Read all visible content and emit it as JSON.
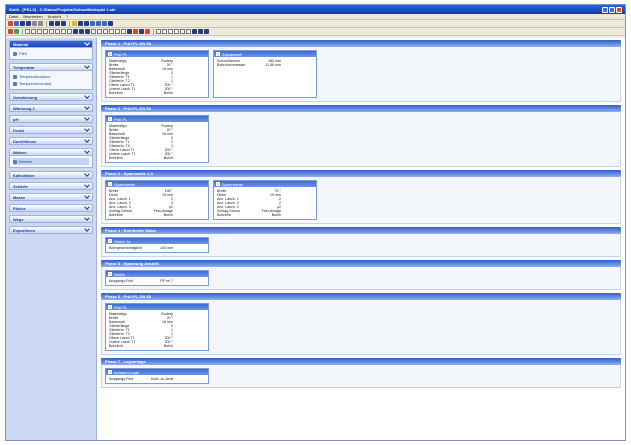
{
  "window": {
    "title": "Sinfö - [PS1.0] - C:\\Daten\\Projekte\\Schweißbeispiel 1.sin"
  },
  "menu": [
    "Datei",
    "Bearbeiten",
    "Ansicht",
    "?"
  ],
  "sidebar": {
    "groups": [
      {
        "label": "Material",
        "active": true,
        "items": [
          {
            "label": "Pfeil",
            "selected": false
          }
        ]
      },
      {
        "label": "Temperatur",
        "active": false,
        "items": [
          {
            "label": "Temperaturzyklus",
            "selected": false
          },
          {
            "label": "Temperaturverlauf",
            "selected": false
          }
        ]
      },
      {
        "label": "Vorwärmung",
        "active": false,
        "items": []
      },
      {
        "label": "Wärmung 2",
        "active": false,
        "items": []
      },
      {
        "label": "pH",
        "active": false,
        "items": []
      },
      {
        "label": "Druck",
        "active": false,
        "items": []
      },
      {
        "label": "Durchflüsse",
        "active": false,
        "items": []
      },
      {
        "label": "Walzen",
        "active": false,
        "items": [
          {
            "label": "Walzen",
            "selected": true
          }
        ]
      },
      {
        "label": "Kalkulation",
        "active": false,
        "items": []
      },
      {
        "label": "Schärfe",
        "active": false,
        "items": []
      },
      {
        "label": "Masse",
        "active": false,
        "items": []
      },
      {
        "label": "Fläche",
        "active": false,
        "items": []
      },
      {
        "label": "Wege",
        "active": false,
        "items": []
      },
      {
        "label": "Exportieren",
        "active": false,
        "items": []
      }
    ]
  },
  "phases": [
    {
      "title": "Phase 1 : Prüf-PL-DN 85",
      "cards": [
        {
          "title": "Prüf PL",
          "rows": [
            {
              "k": "Materialtyp",
              "v": "Ruderp"
            },
            {
              "k": "Breite",
              "v": "20 °"
            },
            {
              "k": "Basismaß",
              "v": "16 mm"
            },
            {
              "k": "Gliederlänge",
              "v": "0"
            },
            {
              "k": "Gliederbr. T1",
              "v": "1"
            },
            {
              "k": "Gliederbr. T2",
              "v": "1"
            },
            {
              "k": "Obere Lasch T1",
              "v": "200 °"
            },
            {
              "k": "Untere Lasch T1",
              "v": "200 °"
            },
            {
              "k": "Bohrlinie",
              "v": "Butch"
            }
          ]
        },
        {
          "title": "Zusatzstoff",
          "rows": [
            {
              "k": "Schweißstrom",
              "v": "180 mm"
            },
            {
              "k": "Bohrdurchmesser",
              "v": "11,88 mm"
            }
          ]
        }
      ]
    },
    {
      "title": "Phase 2 : Prüf-PL-DN 90",
      "cards": [
        {
          "title": "Prüf PL",
          "rows": [
            {
              "k": "Materialtyp",
              "v": "Ruderp"
            },
            {
              "k": "Breite",
              "v": "20 °"
            },
            {
              "k": "Basismaß",
              "v": "16 mm"
            },
            {
              "k": "Gliederlänge",
              "v": "0"
            },
            {
              "k": "Gliederbr. T1",
              "v": "1"
            },
            {
              "k": "Gliederbr. T2",
              "v": "1"
            },
            {
              "k": "Obere Lasch T1",
              "v": "200 °"
            },
            {
              "k": "Untere Lasch T1",
              "v": "200 °"
            },
            {
              "k": "Bohrlinie",
              "v": "Butch"
            }
          ]
        }
      ]
    },
    {
      "title": "Phase 3 : Spannweite 1-3",
      "cards": [
        {
          "title": "Spannweite",
          "rows": [
            {
              "k": "Breite",
              "v": "198 °"
            },
            {
              "k": "Dicke",
              "v": "19 mm"
            },
            {
              "k": "Anz. Lasch. 1",
              "v": "2"
            },
            {
              "k": "Anz. Lasch. 2",
              "v": "2"
            },
            {
              "k": "Anz. Lasch. 3",
              "v": "p2"
            },
            {
              "k": "Schlag-Schutz",
              "v": "Fest-Anlage"
            },
            {
              "k": "Bohrlinie",
              "v": "Butch"
            }
          ]
        },
        {
          "title": "Spannweite",
          "rows": [
            {
              "k": "Breite",
              "v": "75 °"
            },
            {
              "k": "Dicke",
              "v": "19 mm"
            },
            {
              "k": "Anz. Lasch. 1",
              "v": "2"
            },
            {
              "k": "Anz. Lasch. 2",
              "v": "2"
            },
            {
              "k": "Anz. Lasch. 3",
              "v": "p2"
            },
            {
              "k": "Schlag-Schutz",
              "v": "Fest-Anlage"
            },
            {
              "k": "Bohrlinie",
              "v": "Butch"
            }
          ]
        }
      ]
    },
    {
      "title": "Phase 4 : Bohrbreite Walze",
      "cards": [
        {
          "title": "Walze 1a",
          "rows": [
            {
              "k": "Bohrgeschwindigkeit",
              "v": "100 mm"
            }
          ]
        }
      ]
    },
    {
      "title": "Phase 5 : Spannung Anstellt",
      "cards": [
        {
          "title": "Walze",
          "rows": [
            {
              "k": "Ausgangs-Feld",
              "v": "PP rel 7"
            }
          ]
        }
      ]
    },
    {
      "title": "Phase 6 : Prüf-PL-DN 85",
      "cards": [
        {
          "title": "Prüf PL",
          "rows": [
            {
              "k": "Materialtyp",
              "v": "Ruderp"
            },
            {
              "k": "Breite",
              "v": "20 °"
            },
            {
              "k": "Basismaß",
              "v": "16 mm"
            },
            {
              "k": "Gliederlänge",
              "v": "0"
            },
            {
              "k": "Gliederbr. T1",
              "v": "1"
            },
            {
              "k": "Gliederbr. T2",
              "v": "1"
            },
            {
              "k": "Obere Lasch T1",
              "v": "200 °"
            },
            {
              "k": "Untere Lasch T1",
              "v": "200 °"
            },
            {
              "k": "Bohrlinie",
              "v": "Butch"
            }
          ]
        }
      ]
    },
    {
      "title": "Phase 7 : Lageanlage",
      "cards": [
        {
          "title": "Anlagen-Lage",
          "rows": [
            {
              "k": "Ausgangs-Feld",
              "v": "Konf.-zu-Anlieferung"
            }
          ]
        }
      ]
    }
  ]
}
